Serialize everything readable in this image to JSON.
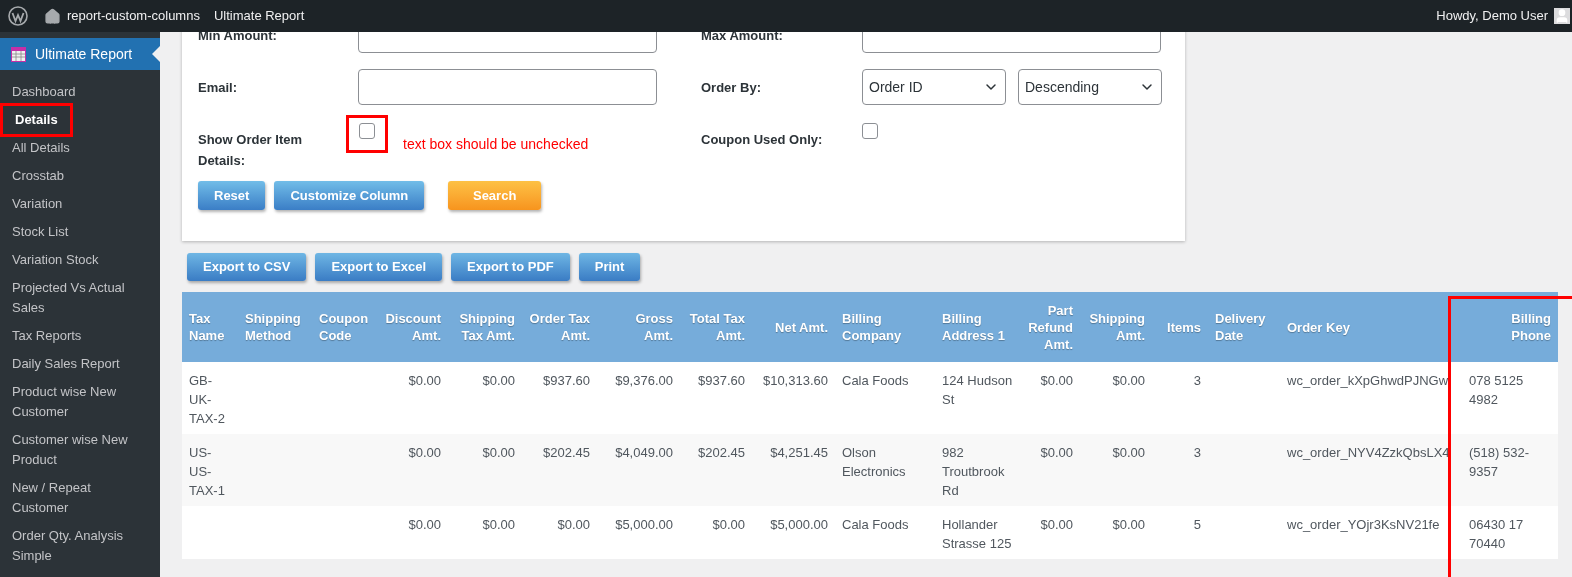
{
  "top_bar": {
    "site_name": "report-custom-columns",
    "menu_item": "Ultimate Report",
    "greeting": "Howdy, Demo User"
  },
  "sidebar": {
    "title": "Ultimate Report",
    "items": [
      {
        "label": "Dashboard",
        "selected": false,
        "highlighted": false
      },
      {
        "label": "Details",
        "selected": true,
        "highlighted": true
      },
      {
        "label": "All Details",
        "selected": false,
        "highlighted": false
      },
      {
        "label": "Crosstab",
        "selected": false,
        "highlighted": false
      },
      {
        "label": "Variation",
        "selected": false,
        "highlighted": false
      },
      {
        "label": "Stock List",
        "selected": false,
        "highlighted": false
      },
      {
        "label": "Variation Stock",
        "selected": false,
        "highlighted": false
      },
      {
        "label": "Projected Vs Actual Sales",
        "selected": false,
        "highlighted": false
      },
      {
        "label": "Tax Reports",
        "selected": false,
        "highlighted": false
      },
      {
        "label": "Daily Sales Report",
        "selected": false,
        "highlighted": false
      },
      {
        "label": "Product wise New Customer",
        "selected": false,
        "highlighted": false
      },
      {
        "label": "Customer wise New Product",
        "selected": false,
        "highlighted": false
      },
      {
        "label": "New / Repeat Customer",
        "selected": false,
        "highlighted": false
      },
      {
        "label": "Order Qty. Analysis Simple",
        "selected": false,
        "highlighted": false
      }
    ]
  },
  "filters": [
    {
      "kind": "text",
      "label": "Min Amount:"
    },
    {
      "kind": "text",
      "label": "Max Amount:"
    },
    {
      "kind": "text",
      "label": "Email:"
    },
    {
      "kind": "select",
      "label": "Order By:",
      "values": [
        "Order ID",
        "Descending"
      ]
    },
    {
      "kind": "checkbox",
      "label": "Show Order Item Details:",
      "checked": false,
      "highlighted": true,
      "annotation": "text box should be unchecked"
    },
    {
      "kind": "checkbox",
      "label": "Coupon Used Only:",
      "checked": false
    }
  ],
  "buttons": [
    {
      "label": "Reset",
      "kind": "primary"
    },
    {
      "label": "Customize Column",
      "kind": "primary"
    },
    {
      "label": "Search",
      "kind": "accent"
    }
  ],
  "export_buttons": [
    "Export to CSV",
    "Export to Excel",
    "Export to PDF",
    "Print"
  ],
  "table": {
    "columns": [
      {
        "label": "Tax Name",
        "kind": "text",
        "highlighted": false
      },
      {
        "label": "Shipping Method",
        "kind": "text",
        "highlighted": false
      },
      {
        "label": "Coupon Code",
        "kind": "text",
        "highlighted": false
      },
      {
        "label": "Discount Amt.",
        "kind": "amount",
        "highlighted": false
      },
      {
        "label": "Shipping Tax Amt.",
        "kind": "amount",
        "highlighted": false
      },
      {
        "label": "Order Tax Amt.",
        "kind": "amount",
        "highlighted": false
      },
      {
        "label": "Gross Amt.",
        "kind": "amount",
        "highlighted": false
      },
      {
        "label": "Total Tax Amt.",
        "kind": "amount",
        "highlighted": false
      },
      {
        "label": "Net Amt.",
        "kind": "amount",
        "highlighted": false
      },
      {
        "label": "Billing Company",
        "kind": "text",
        "highlighted": false
      },
      {
        "label": "Billing Address 1",
        "kind": "text",
        "highlighted": false
      },
      {
        "label": "Part Refund Amt.",
        "kind": "amount",
        "highlighted": false
      },
      {
        "label": "Shipping Amt.",
        "kind": "amount",
        "highlighted": false
      },
      {
        "label": "Items",
        "kind": "amount",
        "highlighted": false
      },
      {
        "label": "Delivery Date",
        "kind": "text",
        "highlighted": false
      },
      {
        "label": "Order Key",
        "kind": "text",
        "highlighted": false
      },
      {
        "label": "Billing Phone",
        "kind": "phone",
        "highlighted": true
      }
    ],
    "rows": [
      [
        "GB-UK-TAX-2",
        null,
        null,
        "$0.00",
        "$0.00",
        "$937.60",
        "$9,376.00",
        "$937.60",
        "$10,313.60",
        "Cala Foods",
        "124 Hudson St",
        "$0.00",
        "$0.00",
        "3",
        null,
        "wc_order_kXpGhwdPJNGw",
        "078 5125 4982"
      ],
      [
        "US-US-TAX-1",
        null,
        null,
        "$0.00",
        "$0.00",
        "$202.45",
        "$4,049.00",
        "$202.45",
        "$4,251.45",
        "Olson Electronics",
        "982 Troutbrook Rd",
        "$0.00",
        "$0.00",
        "3",
        null,
        "wc_order_NYV4ZzkQbsLX4",
        "(518) 532-9357"
      ],
      [
        null,
        null,
        null,
        "$0.00",
        "$0.00",
        "$0.00",
        "$5,000.00",
        "$0.00",
        "$5,000.00",
        "Cala Foods",
        "Hollander Strasse 125",
        "$0.00",
        "$0.00",
        "5",
        null,
        "wc_order_YOjr3KsNV21fe",
        "06430 17 70440"
      ]
    ]
  }
}
